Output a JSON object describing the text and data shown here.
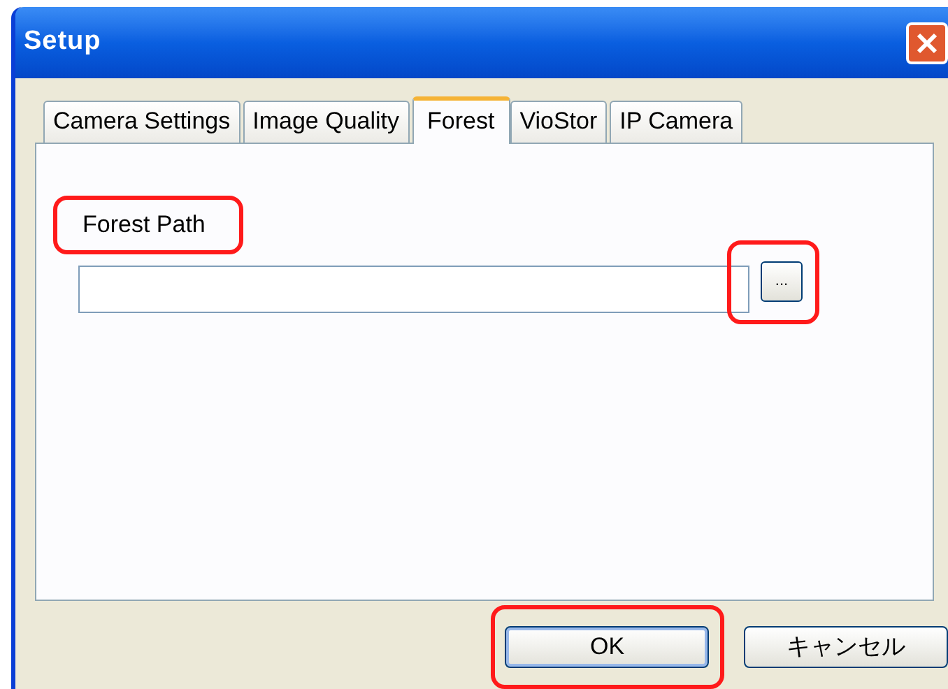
{
  "window": {
    "title": "Setup"
  },
  "tabs": [
    {
      "label": "Camera Settings",
      "selected": false
    },
    {
      "label": "Image Quality",
      "selected": false
    },
    {
      "label": "Forest",
      "selected": true
    },
    {
      "label": "VioStor",
      "selected": false
    },
    {
      "label": "IP Camera",
      "selected": false
    }
  ],
  "forest_path": {
    "label": "Forest Path",
    "label_highlighted": true,
    "browse_label": "...",
    "browse_highlighted": true
  },
  "buttons": [
    {
      "label": "OK",
      "highlighted": true
    },
    {
      "label": "キャンセル",
      "highlighted": false
    }
  ]
}
